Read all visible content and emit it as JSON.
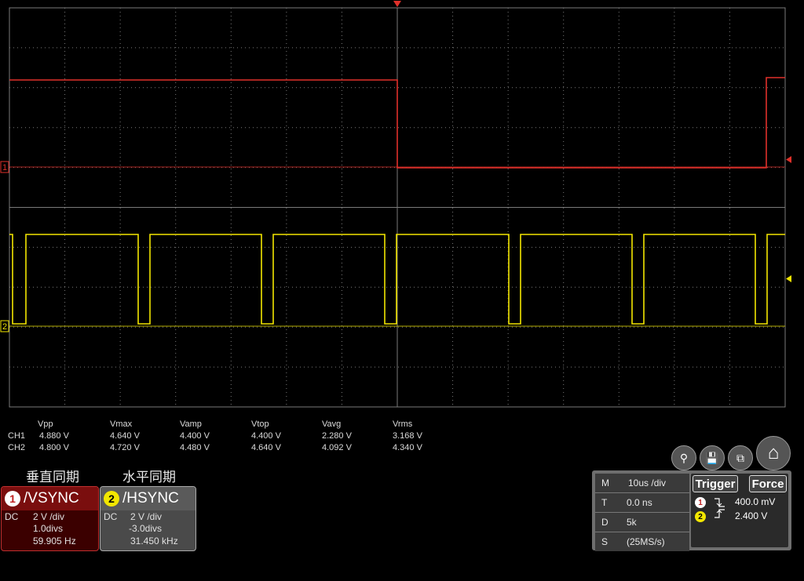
{
  "measurements": {
    "headers": [
      "Vpp",
      "Vmax",
      "Vamp",
      "Vtop",
      "Vavg",
      "Vrms"
    ],
    "rows": [
      {
        "ch": "CH1",
        "values": [
          "4.880 V",
          "4.640 V",
          "4.400 V",
          "4.400 V",
          "2.280 V",
          "3.168 V"
        ]
      },
      {
        "ch": "CH2",
        "values": [
          "4.800 V",
          "4.720 V",
          "4.480 V",
          "4.640 V",
          "4.092 V",
          "4.340 V"
        ]
      }
    ]
  },
  "channels": [
    {
      "caption": "垂直同期",
      "badge": "1",
      "name": "/VSYNC",
      "coupling": "DC",
      "scale": "2 V /div",
      "offset": "1.0divs",
      "freq": "59.905 Hz",
      "color": "#e0302a"
    },
    {
      "caption": "水平同期",
      "badge": "2",
      "name": "/HSYNC",
      "coupling": "DC",
      "scale": "2 V /div",
      "offset": "-3.0divs",
      "freq": "31.450 kHz",
      "color": "#f2e600"
    }
  ],
  "timebase": {
    "rows": [
      {
        "key": "M",
        "val": "10us /div"
      },
      {
        "key": "T",
        "val": "0.0 ns"
      },
      {
        "key": "D",
        "val": "5k"
      },
      {
        "key": "S",
        "val": "(25MS/s)"
      }
    ]
  },
  "trigger": {
    "trigger_label": "Trigger",
    "force_label": "Force",
    "levels": [
      {
        "badge": "1",
        "value": "400.0 mV",
        "edge": "falling"
      },
      {
        "badge": "2",
        "value": "2.400 V",
        "edge": "rising"
      }
    ]
  },
  "markers": {
    "ch1": "1",
    "ch2": "2"
  },
  "toolbar_icons": [
    "zoom-icon",
    "save-icon",
    "window-icon",
    "home-icon"
  ],
  "colors": {
    "ch1": "#e0302a",
    "ch2": "#f2e600",
    "grid": "#7a7a7a"
  }
}
